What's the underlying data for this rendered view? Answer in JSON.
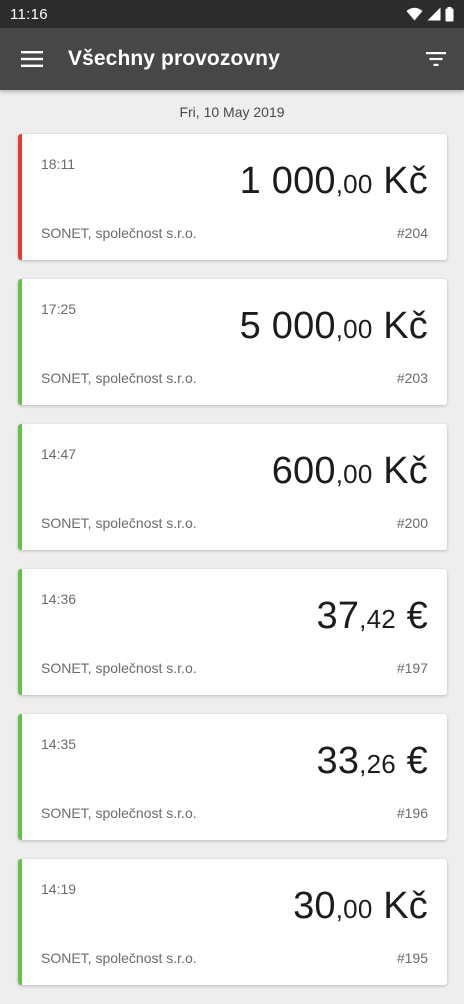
{
  "status_bar": {
    "time": "11:16",
    "icons": [
      "wifi-icon",
      "signal-icon",
      "battery-icon"
    ]
  },
  "app_bar": {
    "title": "Všechny provozovny",
    "menu_icon": "menu-icon",
    "filter_icon": "filter-icon"
  },
  "date_header": "Fri, 10 May 2019",
  "colors": {
    "status_bar": "#2c2c2c",
    "app_bar": "#474747",
    "stripe_red": "#e53935",
    "stripe_green": "#62c24a",
    "background": "#eeeeee"
  },
  "transactions": [
    {
      "time": "18:11",
      "amount_int": "1 000",
      "amount_dec": ",00",
      "currency": " Kč",
      "company": "SONET, společnost s.r.o.",
      "number": "#204",
      "status": "red"
    },
    {
      "time": "17:25",
      "amount_int": "5 000",
      "amount_dec": ",00",
      "currency": " Kč",
      "company": "SONET, společnost s.r.o.",
      "number": "#203",
      "status": "green"
    },
    {
      "time": "14:47",
      "amount_int": "600",
      "amount_dec": ",00",
      "currency": " Kč",
      "company": "SONET, společnost s.r.o.",
      "number": "#200",
      "status": "green"
    },
    {
      "time": "14:36",
      "amount_int": "37",
      "amount_dec": ",42",
      "currency": " €",
      "company": "SONET, společnost s.r.o.",
      "number": "#197",
      "status": "green"
    },
    {
      "time": "14:35",
      "amount_int": "33",
      "amount_dec": ",26",
      "currency": " €",
      "company": "SONET, společnost s.r.o.",
      "number": "#196",
      "status": "green"
    },
    {
      "time": "14:19",
      "amount_int": "30",
      "amount_dec": ",00",
      "currency": " Kč",
      "company": "SONET, společnost s.r.o.",
      "number": "#195",
      "status": "green"
    }
  ]
}
